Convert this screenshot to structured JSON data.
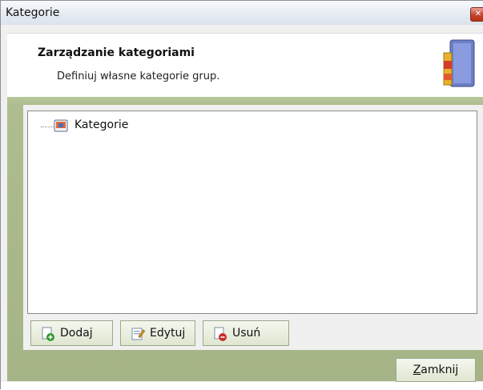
{
  "window": {
    "title": "Kategorie"
  },
  "header": {
    "title": "Zarządzanie kategoriami",
    "subtitle": "Definiuj własne kategorie grup."
  },
  "tree": {
    "root_label": "Kategorie"
  },
  "buttons": {
    "add": "Dodaj",
    "edit": "Edytuj",
    "delete": "Usuń",
    "close_mnemonic": "Z",
    "close_rest": "amknij"
  },
  "colors": {
    "accent_green": "#a5b486",
    "title_gradient_top": "#f7f9fc",
    "close_red": "#c7402a"
  },
  "icons": [
    "close-icon",
    "books-icon",
    "category-tree-icon",
    "add-icon",
    "edit-icon",
    "delete-icon"
  ]
}
